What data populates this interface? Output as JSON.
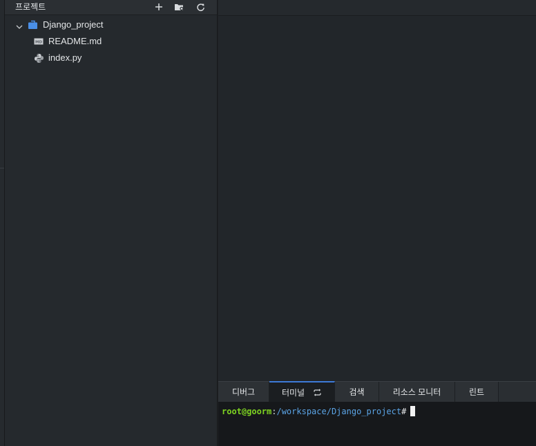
{
  "sidebar": {
    "title": "프로젝트",
    "actions": {
      "add": "plus-icon",
      "new_folder": "folder-settings-icon",
      "refresh": "refresh-icon"
    },
    "tree": {
      "root": {
        "label": "Django_project",
        "icon": "project-folder-icon",
        "expanded": true,
        "color": "#4a8fe7"
      },
      "files": [
        {
          "label": "README.md",
          "icon": "markdown-file-icon"
        },
        {
          "label": "index.py",
          "icon": "python-file-icon"
        }
      ]
    }
  },
  "bottom_panel": {
    "tabs": [
      {
        "label": "디버그",
        "active": false
      },
      {
        "label": "터미널",
        "active": true
      },
      {
        "label": "검색",
        "active": false
      },
      {
        "label": "리소스 모니터",
        "active": false
      },
      {
        "label": "린트",
        "active": false
      }
    ],
    "accent_color": "#3d7bd9"
  },
  "terminal": {
    "user_host": "root@goorm",
    "separator": ":",
    "path": "/workspace/Django_project",
    "prompt_symbol": "#",
    "user_color": "#7ed321",
    "path_color": "#5ba4e6"
  }
}
